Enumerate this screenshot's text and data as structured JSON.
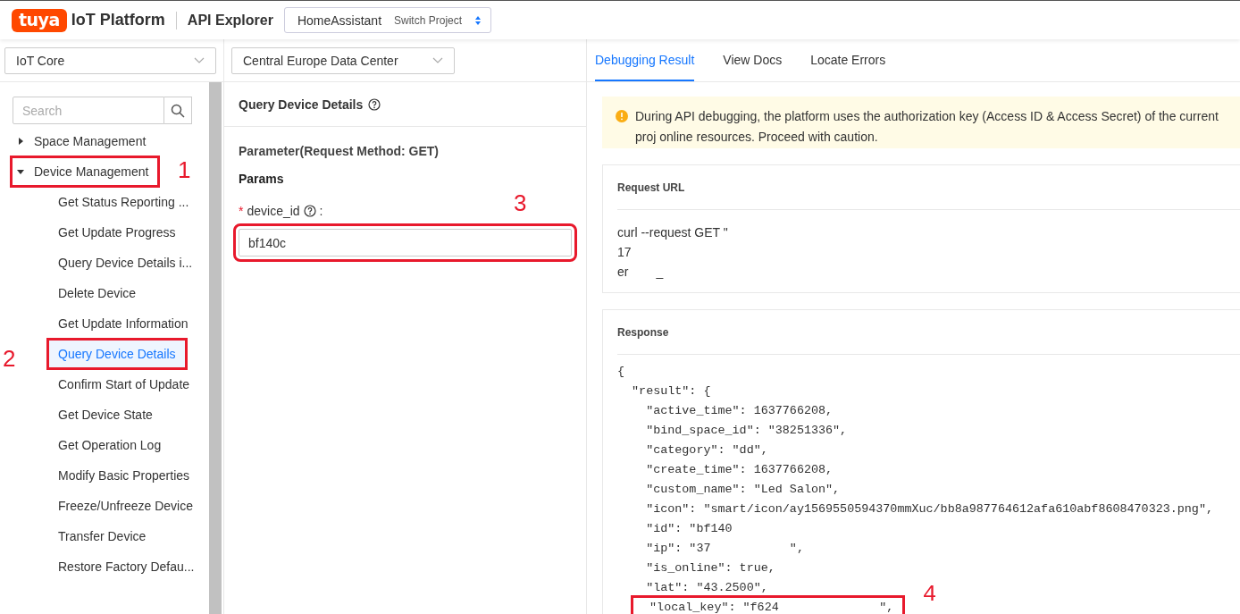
{
  "header": {
    "logo_text": "tuya",
    "product": "IoT Platform",
    "section": "API Explorer",
    "project": {
      "name": "HomeAssistant",
      "action": "Switch Project"
    }
  },
  "sidebar": {
    "service_select": "IoT Core",
    "search": {
      "placeholder": "Search"
    },
    "tree": [
      {
        "label": "Space Management",
        "expanded": false
      },
      {
        "label": "Device Management",
        "expanded": true,
        "annotation": "1",
        "children": [
          {
            "label": "Get Status Reporting ...",
            "selected": false
          },
          {
            "label": "Get Update Progress",
            "selected": false
          },
          {
            "label": "Query Device Details i...",
            "selected": false
          },
          {
            "label": "Delete Device",
            "selected": false
          },
          {
            "label": "Get Update Information",
            "selected": false
          },
          {
            "label": "Query Device Details",
            "selected": true,
            "annotation": "2"
          },
          {
            "label": "Confirm Start of Update",
            "selected": false
          },
          {
            "label": "Get Device State",
            "selected": false
          },
          {
            "label": "Get Operation Log",
            "selected": false
          },
          {
            "label": "Modify Basic Properties",
            "selected": false
          },
          {
            "label": "Freeze/Unfreeze Device",
            "selected": false
          },
          {
            "label": "Transfer Device",
            "selected": false
          },
          {
            "label": "Restore Factory Defau...",
            "selected": false
          }
        ]
      }
    ]
  },
  "params_panel": {
    "region_select": "Central Europe Data Center",
    "title": "Query Device Details",
    "method_label": "Parameter(Request Method: GET)",
    "section": "Params",
    "fields": [
      {
        "name": "device_id",
        "required": true,
        "required_mark": "*",
        "separator": ":",
        "value": "bf140c",
        "annotation": "3"
      }
    ]
  },
  "result_panel": {
    "tabs": [
      {
        "label": "Debugging Result",
        "selected": true
      },
      {
        "label": "View Docs",
        "selected": false
      },
      {
        "label": "Locate Errors",
        "selected": false
      }
    ],
    "warning": "During API debugging, the platform uses the authorization key (Access ID & Access Secret) of the current proj online resources. Proceed with caution.",
    "request_url": {
      "title": "Request URL",
      "lines": [
        "curl --request GET \"",
        "17",
        "er        _"
      ]
    },
    "response": {
      "title": "Response",
      "lines": [
        {
          "text": "{"
        },
        {
          "text": "  \"result\": {"
        },
        {
          "text": "    \"active_time\": 1637766208,"
        },
        {
          "text": "    \"bind_space_id\": \"38251336\","
        },
        {
          "text": "    \"category\": \"dd\","
        },
        {
          "text": "    \"create_time\": 1637766208,"
        },
        {
          "text": "    \"custom_name\": \"Led Salon\","
        },
        {
          "text": "    \"icon\": \"smart/icon/ay1569550594370mmXuc/bb8a987764612afa610abf8608470323.png\","
        },
        {
          "text": "    \"id\": \"bf140"
        },
        {
          "text": "    \"ip\": \"37           \","
        },
        {
          "text": "    \"is_online\": true,"
        },
        {
          "text": "    \"lat\": \"43.2500\","
        },
        {
          "text": "    \"local_key\": \"f624              \",",
          "annotation": "4"
        }
      ]
    }
  }
}
